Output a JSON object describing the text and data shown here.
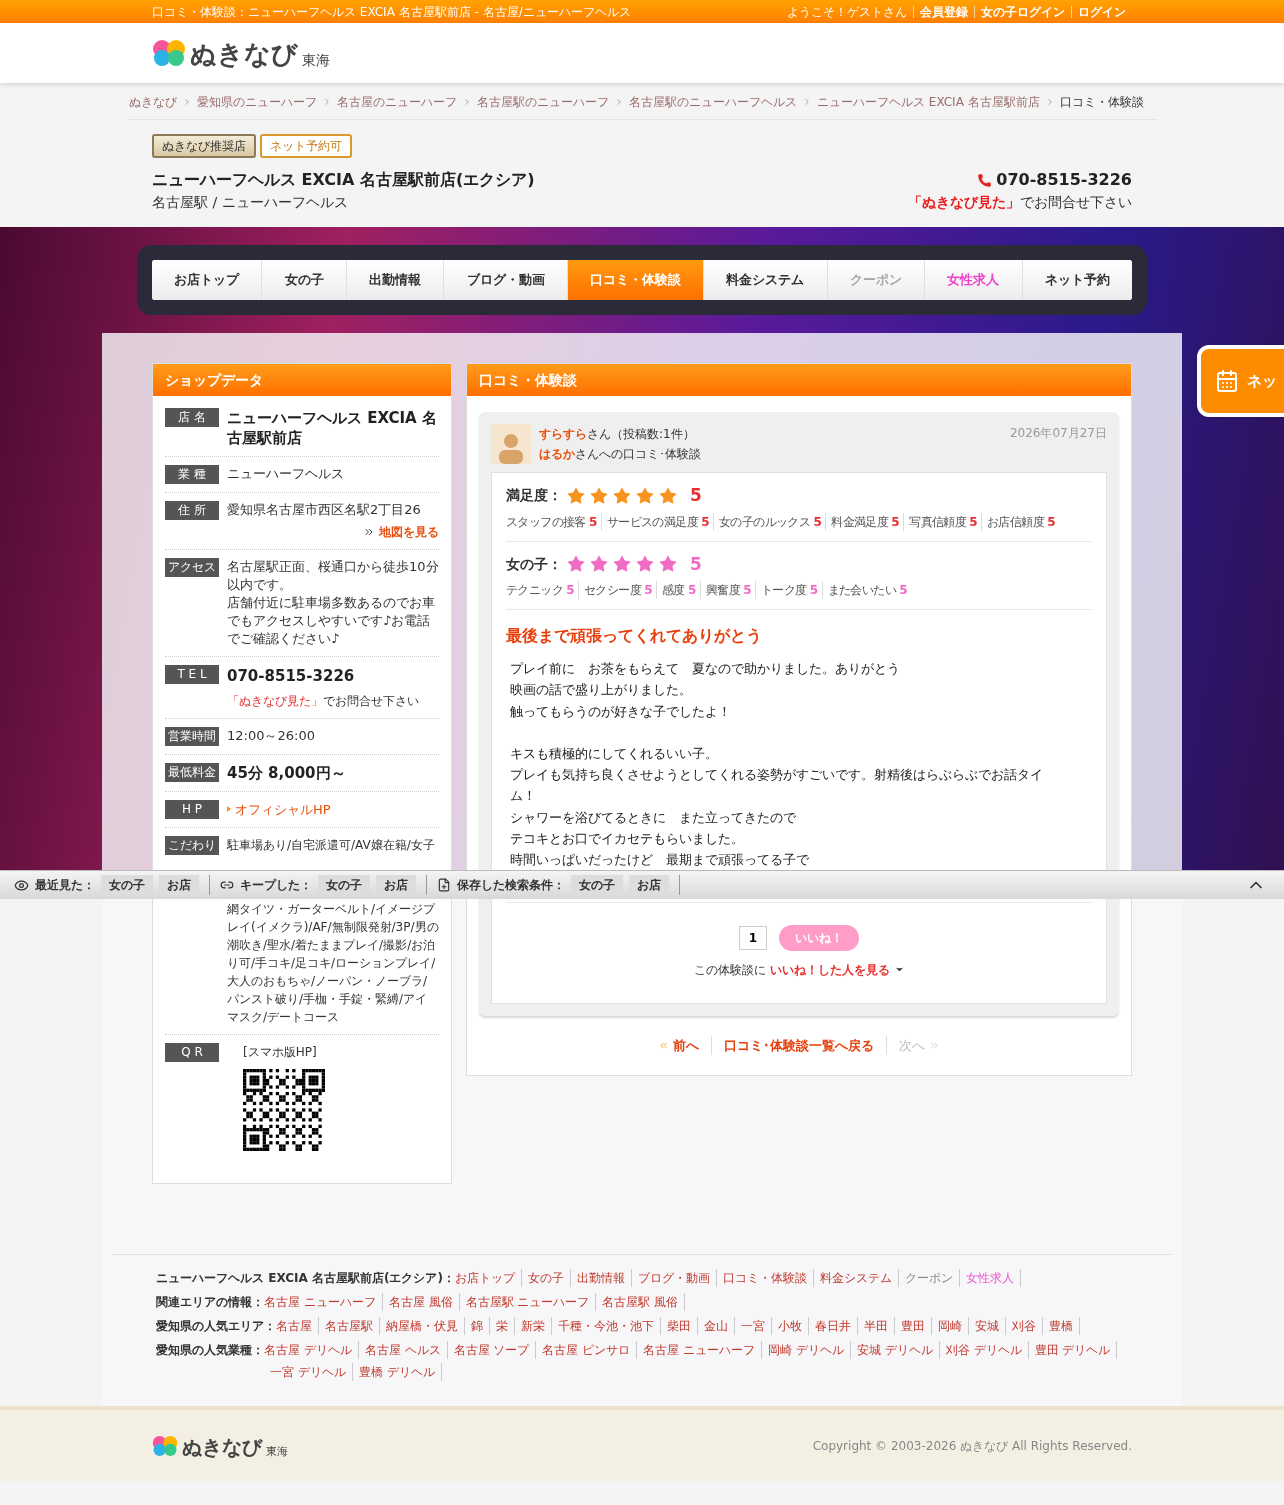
{
  "top_bar": {
    "title": "口コミ・体験談：ニューハーフヘルス EXCIA 名古屋駅前店 - 名古屋/ニューハーフヘルス",
    "greeting": "ようこそ！ゲストさん",
    "links": [
      "会員登録",
      "女の子ログイン",
      "ログイン"
    ]
  },
  "header": {
    "logo": "ぬきなび",
    "region": "東海"
  },
  "breadcrumbs": [
    "ぬきなび",
    "愛知県のニューハーフ",
    "名古屋のニューハーフ",
    "名古屋駅のニューハーフ",
    "名古屋駅のニューハーフヘルス",
    "ニューハーフヘルス EXCIA 名古屋駅前店",
    "口コミ・体験談"
  ],
  "shop": {
    "badges": [
      {
        "label": "ぬきなび推奨店",
        "kind": "filled"
      },
      {
        "label": "ネット予約可",
        "kind": "outline"
      }
    ],
    "name": "ニューハーフヘルス EXCIA 名古屋駅前店(エクシア)",
    "subtitle": "名古屋駅 / ニューハーフヘルス",
    "phone": "070-8515-3226",
    "note_highlight": "「ぬきなび見た」",
    "note": "でお問合せ下さい"
  },
  "nav_tabs": [
    {
      "label": "お店トップ",
      "selected": false,
      "kind": "normal"
    },
    {
      "label": "女の子",
      "selected": false,
      "kind": "normal"
    },
    {
      "label": "出勤情報",
      "selected": false,
      "kind": "normal"
    },
    {
      "label": "ブログ・動画",
      "selected": false,
      "kind": "normal"
    },
    {
      "label": "口コミ・体験談",
      "selected": true,
      "kind": "normal"
    },
    {
      "label": "料金システム",
      "selected": false,
      "kind": "normal"
    },
    {
      "label": "クーポン",
      "selected": false,
      "kind": "muted"
    },
    {
      "label": "女性求人",
      "selected": false,
      "kind": "pink"
    },
    {
      "label": "ネット予約",
      "selected": false,
      "kind": "normal"
    }
  ],
  "floating_button": {
    "label": "ネッ"
  },
  "shop_data": {
    "title": "ショップデータ",
    "rows": [
      {
        "label": "店 名",
        "kind": "bold",
        "lines": [
          "ニューハーフヘルス EXCIA 名古屋駅前店"
        ]
      },
      {
        "label": "業 種",
        "kind": "text",
        "lines": [
          "ニューハーフヘルス"
        ]
      },
      {
        "label": "住 所",
        "kind": "text",
        "lines": [
          "愛知県名古屋市西区名駅2丁目26"
        ],
        "link": "地図を見る"
      },
      {
        "label": "アクセス",
        "kind": "text",
        "lines": [
          "名古屋駅正面、桜通口から徒歩10分以内です。",
          "店舗付近に駐車場多数あるのでお車でもアクセスしやすいです♪お電話でご確認ください♪"
        ]
      },
      {
        "label": "T E L",
        "kind": "tel",
        "lines": [
          "070-8515-3226"
        ],
        "note_highlight": "「ぬきなび見た」",
        "note": "でお問合せ下さい"
      },
      {
        "label": "営業時間",
        "kind": "text",
        "lines": [
          "12:00～26:00"
        ]
      },
      {
        "label": "最低料金",
        "kind": "bold",
        "lines": [
          "45分 8,000円～"
        ]
      },
      {
        "label": "H P",
        "kind": "hp",
        "lines": [
          "オフィシャルHP"
        ]
      },
      {
        "label": "こだわり",
        "kind": "split",
        "lines": [
          "駐車場あり/自宅派遣可/AV嬢在籍/女子",
          "網タイツ・ガーターベルト/イメージプレイ(イメクラ)/AF/無制限発射/3P/男の潮吹き/聖水/着たままプレイ/撮影/お泊り可/手コキ/足コキ/ローションプレイ/大人のおもちゃ/ノーパン・ノーブラ/パンスト破り/手枷・手錠・緊縛/アイマスク/デートコース"
        ]
      },
      {
        "label": "Q R",
        "kind": "qr",
        "lines": [
          "[スマホ版HP]"
        ]
      }
    ]
  },
  "review": {
    "title": "口コミ・体験談",
    "reviewer": "すらすら",
    "reviewer_suffix": "さん（投稿数:1件）",
    "girl": "はるか",
    "girl_suffix": "さんへの口コミ･体験談",
    "date": "2026年07月27日",
    "ratings": [
      {
        "label": "満足度：",
        "stars": 5,
        "score": "5",
        "color": "#f7931e",
        "items": [
          {
            "label": "スタッフの接客",
            "score": "5"
          },
          {
            "label": "サービスの満足度",
            "score": "5"
          },
          {
            "label": "女の子のルックス",
            "score": "5"
          },
          {
            "label": "料金満足度",
            "score": "5"
          },
          {
            "label": "写真信頼度",
            "score": "5"
          },
          {
            "label": "お店信頼度",
            "score": "5"
          }
        ]
      },
      {
        "label": "女の子：",
        "stars": 5,
        "score": "5",
        "color": "#f06bc4",
        "items": [
          {
            "label": "テクニック",
            "score": "5"
          },
          {
            "label": "セクシー度",
            "score": "5"
          },
          {
            "label": "感度",
            "score": "5"
          },
          {
            "label": "興奮度",
            "score": "5"
          },
          {
            "label": "トーク度",
            "score": "5"
          },
          {
            "label": "また会いたい",
            "score": "5"
          }
        ]
      }
    ],
    "headline": "最後まで頑張ってくれてありがとう",
    "body": [
      [
        "プレイ前に　お茶をもらえて　夏なので助かりました。ありがとう",
        "映画の話で盛り上がりました。",
        "触ってもらうのが好きな子でしたよ！"
      ],
      [
        "キスも積極的にしてくれるいい子。",
        "プレイも気持ち良くさせようとしてくれる姿勢がすごいです。射精後はらぶらぶでお話タイム！",
        "シャワーを浴びてるときに　また立ってきたので",
        "テコキとお口でイカセテもらいました。",
        "時間いっぱいだったけど　最期まで頑張ってる子で"
      ]
    ],
    "like_count": "1",
    "like_button": "いいね！",
    "like_note": "この体験談に",
    "like_link": "いいね！した人を見る"
  },
  "pager": [
    {
      "label": "前へ",
      "kind": "prev",
      "disabled": false
    },
    {
      "label": "口コミ･体験談一覧へ戻る",
      "kind": "back",
      "disabled": false
    },
    {
      "label": "次へ",
      "kind": "next",
      "disabled": true
    }
  ],
  "bottom_bar": [
    {
      "label": "最近見た：",
      "kind": "eye",
      "items": [
        "女の子",
        "お店"
      ]
    },
    {
      "label": "キープした：",
      "kind": "clip",
      "items": [
        "女の子",
        "お店"
      ]
    },
    {
      "label": "保存した検索条件：",
      "kind": "doc",
      "items": [
        "女の子",
        "お店"
      ]
    }
  ],
  "footer_links": [
    {
      "label": "ニューハーフヘルス EXCIA 名古屋駅前店(エクシア)：",
      "links": [
        {
          "text": "お店トップ",
          "kind": "normal"
        },
        {
          "text": "女の子",
          "kind": "normal"
        },
        {
          "text": "出勤情報",
          "kind": "normal"
        },
        {
          "text": "ブログ・動画",
          "kind": "normal"
        },
        {
          "text": "口コミ・体験談",
          "kind": "normal"
        },
        {
          "text": "料金システム",
          "kind": "normal"
        },
        {
          "text": "クーポン",
          "kind": "muted"
        },
        {
          "text": "女性求人",
          "kind": "pink"
        }
      ]
    },
    {
      "label": "関連エリアの情報：",
      "links": [
        {
          "text": "名古屋 ニューハーフ",
          "kind": "normal"
        },
        {
          "text": "名古屋 風俗",
          "kind": "normal"
        },
        {
          "text": "名古屋駅 ニューハーフ",
          "kind": "normal"
        },
        {
          "text": "名古屋駅 風俗",
          "kind": "normal"
        }
      ]
    },
    {
      "label": "愛知県の人気エリア：",
      "links": [
        {
          "text": "名古屋",
          "kind": "normal"
        },
        {
          "text": "名古屋駅",
          "kind": "normal"
        },
        {
          "text": "納屋橋・伏見",
          "kind": "normal"
        },
        {
          "text": "錦",
          "kind": "normal"
        },
        {
          "text": "栄",
          "kind": "normal"
        },
        {
          "text": "新栄",
          "kind": "normal"
        },
        {
          "text": "千種・今池・池下",
          "kind": "normal"
        },
        {
          "text": "柴田",
          "kind": "normal"
        },
        {
          "text": "金山",
          "kind": "normal"
        },
        {
          "text": "一宮",
          "kind": "normal"
        },
        {
          "text": "小牧",
          "kind": "normal"
        },
        {
          "text": "春日井",
          "kind": "normal"
        },
        {
          "text": "半田",
          "kind": "normal"
        },
        {
          "text": "豊田",
          "kind": "normal"
        },
        {
          "text": "岡崎",
          "kind": "normal"
        },
        {
          "text": "安城",
          "kind": "normal"
        },
        {
          "text": "刈谷",
          "kind": "normal"
        },
        {
          "text": "豊橋",
          "kind": "normal"
        }
      ]
    },
    {
      "label": "愛知県の人気業種：",
      "links": [
        {
          "text": "名古屋 デリヘル",
          "kind": "normal"
        },
        {
          "text": "名古屋 ヘルス",
          "kind": "normal"
        },
        {
          "text": "名古屋 ソープ",
          "kind": "normal"
        },
        {
          "text": "名古屋 ピンサロ",
          "kind": "normal"
        },
        {
          "text": "名古屋 ニューハーフ",
          "kind": "normal"
        },
        {
          "text": "岡崎 デリヘル",
          "kind": "normal"
        },
        {
          "text": "安城 デリヘル",
          "kind": "normal"
        },
        {
          "text": "刈谷 デリヘル",
          "kind": "normal"
        },
        {
          "text": "豊田 デリヘル",
          "kind": "normal"
        },
        {
          "text": "一宮 デリヘル",
          "kind": "normal"
        },
        {
          "text": "豊橋 デリヘル",
          "kind": "normal"
        }
      ]
    }
  ],
  "footer": {
    "logo": "ぬきなび",
    "region": "東海",
    "copyright": "Copyright © 2003-2026 ぬきなび All Rights Reserved."
  }
}
